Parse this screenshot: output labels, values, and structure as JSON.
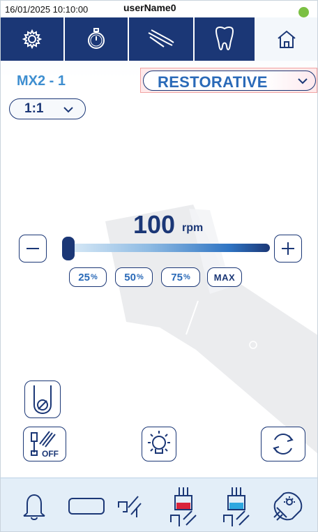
{
  "status_bar": {
    "datetime": "16/01/2025 10:10:00",
    "user": "userName0",
    "status_color": "#7bc043"
  },
  "toolbar": {
    "items": [
      {
        "name": "settings",
        "icon": "gear-icon"
      },
      {
        "name": "timer",
        "icon": "stopwatch-icon"
      },
      {
        "name": "instruments",
        "icon": "handpiece-icon"
      },
      {
        "name": "tooth",
        "icon": "tooth-icon",
        "selected": true
      },
      {
        "name": "home",
        "icon": "home-icon"
      }
    ]
  },
  "instrument": {
    "name": "MX2 - 1",
    "mode": "RESTORATIVE",
    "ratio": "1:1"
  },
  "speed": {
    "value": "100",
    "unit": "rpm",
    "level": 0.0,
    "presets": [
      {
        "num": "25",
        "pct": "%"
      },
      {
        "num": "50",
        "pct": "%"
      },
      {
        "num": "75",
        "pct": "%"
      }
    ],
    "max_label": "MAX"
  },
  "lower_buttons": {
    "off_label": "OFF"
  },
  "bottom_bar": {
    "items": [
      "bell-icon",
      "rectangle-icon",
      "spray-icon",
      "spray-red-icon",
      "spray-blue-icon",
      "light-icon"
    ]
  },
  "colors": {
    "accent_dark": "#1b3776",
    "accent_light": "#3e8ed0",
    "water_red": "#d9233a",
    "water_blue": "#2ea7e0"
  }
}
